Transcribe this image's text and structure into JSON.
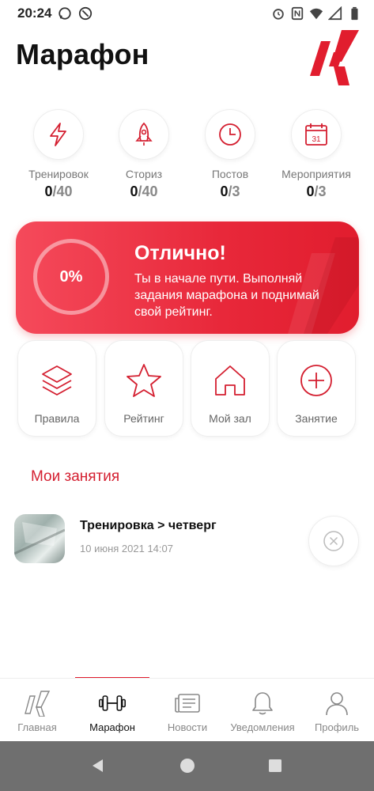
{
  "status_bar": {
    "time": "20:24"
  },
  "header": {
    "title": "Марафон"
  },
  "stats": [
    {
      "label": "Тренировок",
      "done": "0",
      "total": "40",
      "icon": "lightning-icon"
    },
    {
      "label": "Сториз",
      "done": "0",
      "total": "40",
      "icon": "rocket-icon"
    },
    {
      "label": "Постов",
      "done": "0",
      "total": "3",
      "icon": "clock-icon"
    },
    {
      "label": "Мероприятия",
      "done": "0",
      "total": "3",
      "icon": "calendar-icon",
      "calendar_day": "31"
    }
  ],
  "banner": {
    "progress": "0%",
    "title": "Отлично!",
    "text": "Ты в начале пути. Выполняй задания марафона и поднимай свой рейтинг."
  },
  "quick_actions": [
    {
      "label": "Правила",
      "icon": "layers-icon"
    },
    {
      "label": "Рейтинг",
      "icon": "star-icon"
    },
    {
      "label": "Мой зал",
      "icon": "home-icon"
    },
    {
      "label": "Занятие",
      "icon": "plus-circle-icon"
    }
  ],
  "my_sessions": {
    "title": "Мои занятия",
    "items": [
      {
        "title": "Тренировка > четверг",
        "date": "10 июня 2021 14:07"
      }
    ]
  },
  "tabbar": [
    {
      "label": "Главная",
      "icon": "logo-icon",
      "active": false
    },
    {
      "label": "Марафон",
      "icon": "dumbbell-icon",
      "active": true
    },
    {
      "label": "Новости",
      "icon": "newspaper-icon",
      "active": false
    },
    {
      "label": "Уведомления",
      "icon": "bell-icon",
      "active": false
    },
    {
      "label": "Профиль",
      "icon": "user-icon",
      "active": false
    }
  ],
  "colors": {
    "accent": "#e11d2e",
    "banner_start": "#f54a5b",
    "banner_end": "#e11d2e",
    "navbar": "#6f6f6f"
  }
}
